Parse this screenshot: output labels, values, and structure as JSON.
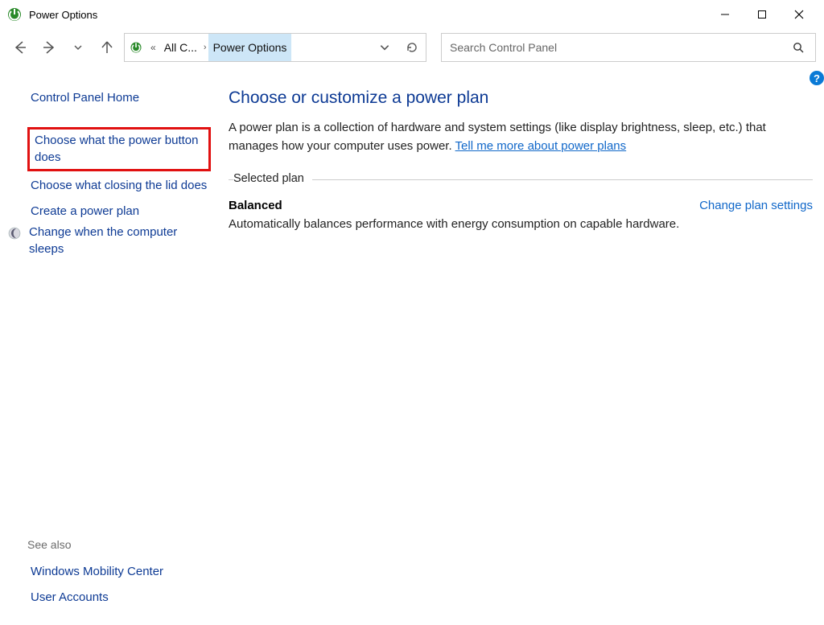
{
  "titlebar": {
    "title": "Power Options"
  },
  "breadcrumb": {
    "items": [
      "All C...",
      "Power Options"
    ]
  },
  "search": {
    "placeholder": "Search Control Panel"
  },
  "sidebar": {
    "home": "Control Panel Home",
    "links": [
      "Choose what the power button does",
      "Choose what closing the lid does",
      "Create a power plan",
      "Change when the computer sleeps"
    ],
    "see_also_label": "See also",
    "see_also": [
      "Windows Mobility Center",
      "User Accounts"
    ]
  },
  "main": {
    "heading": "Choose or customize a power plan",
    "description_prefix": "A power plan is a collection of hardware and system settings (like display brightness, sleep, etc.) that manages how your computer uses power. ",
    "description_link": "Tell me more about power plans",
    "selected_plan_label": "Selected plan",
    "plan": {
      "name": "Balanced",
      "change_link": "Change plan settings",
      "description": "Automatically balances performance with energy consumption on capable hardware."
    },
    "help_glyph": "?"
  }
}
